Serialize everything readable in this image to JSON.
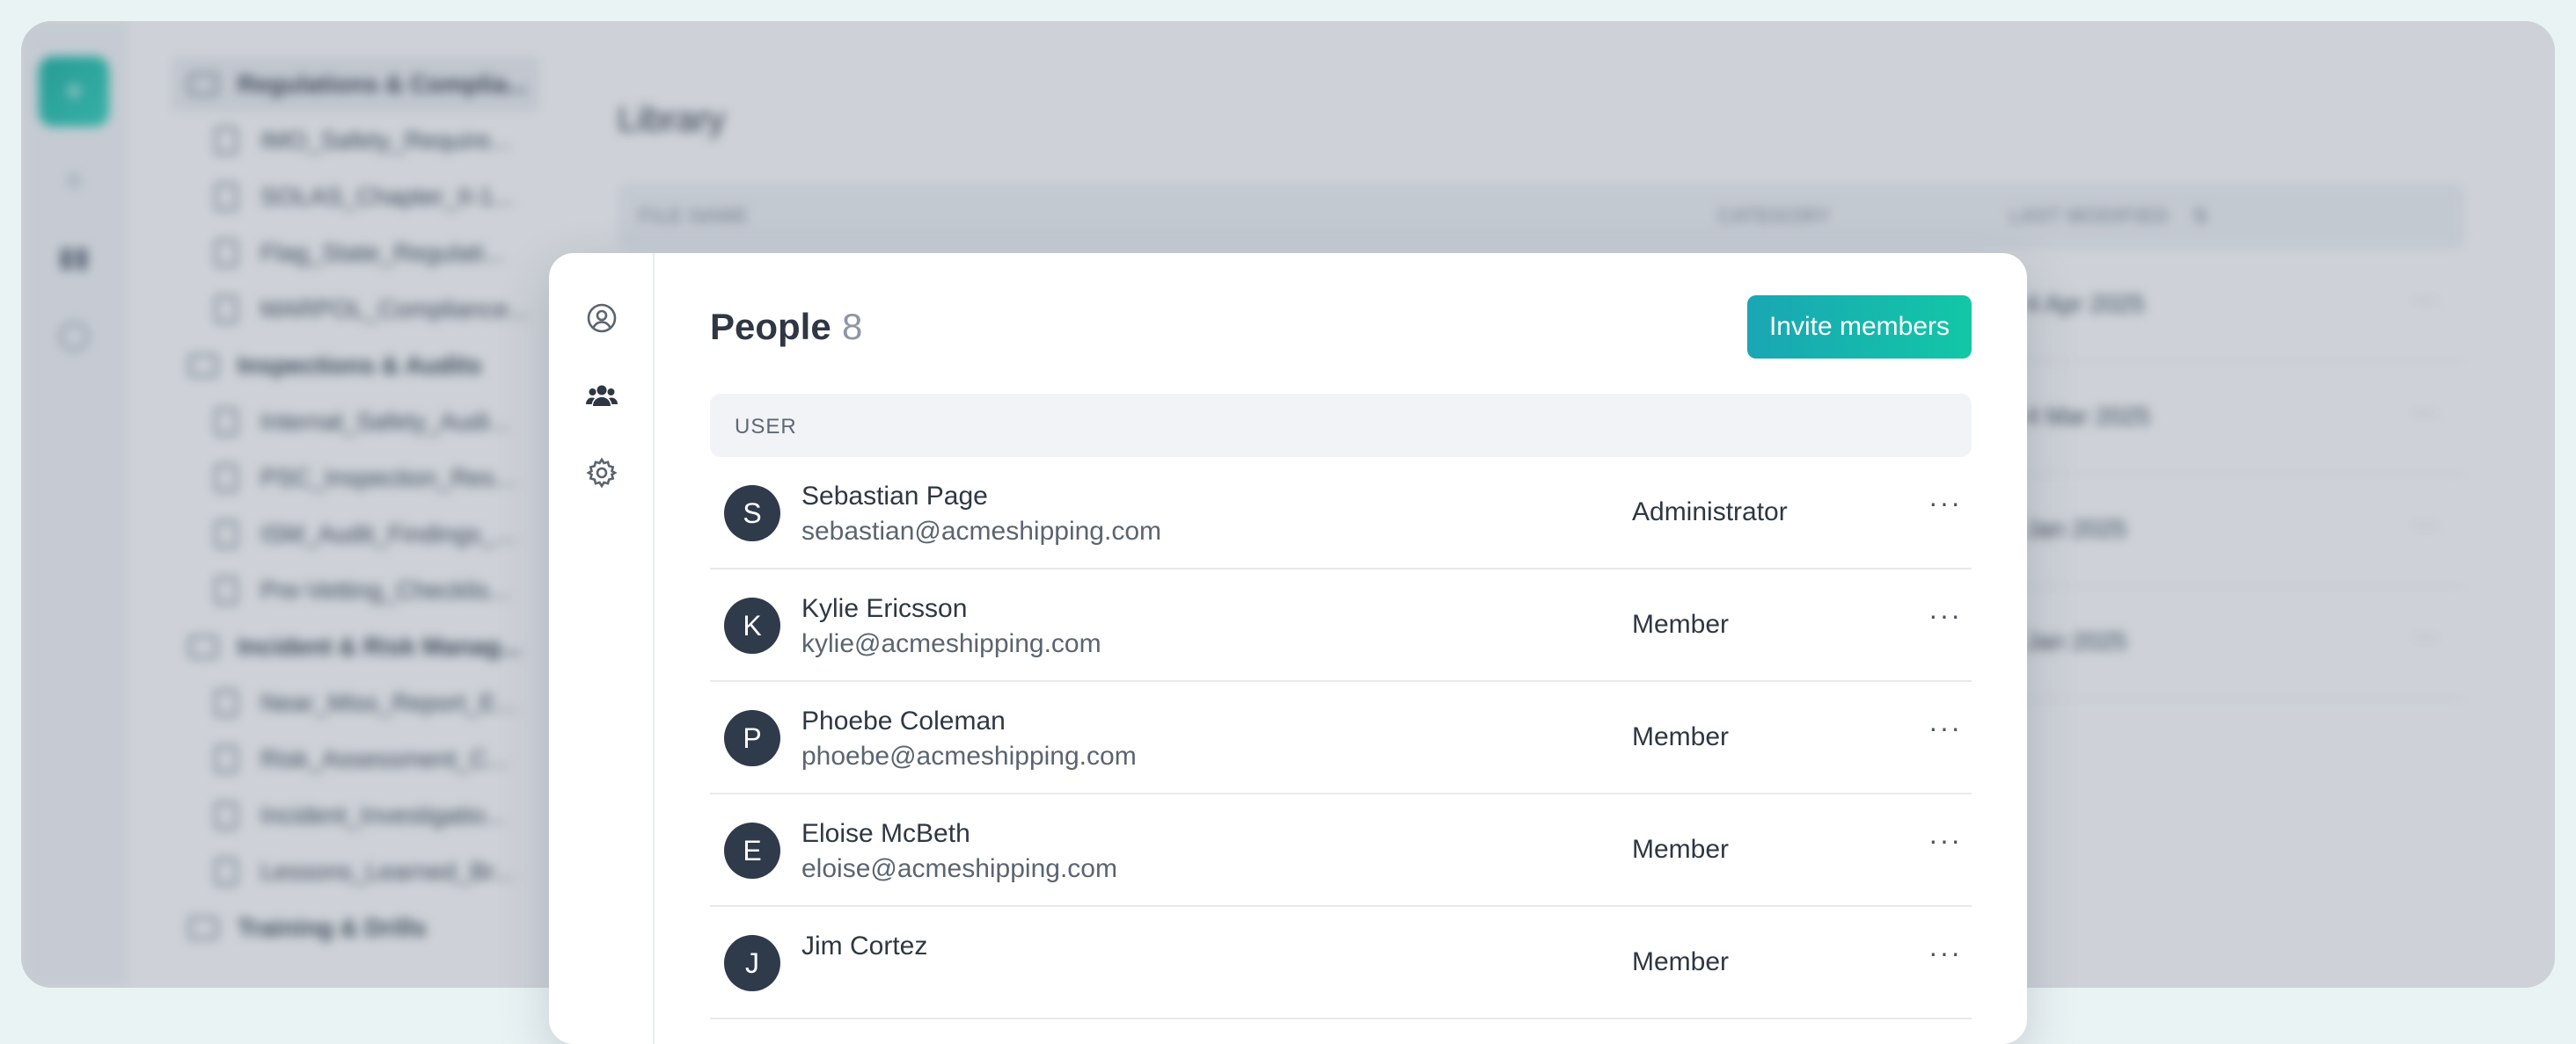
{
  "background": {
    "tree": [
      {
        "type": "folder",
        "label": "Regulations & Complia..."
      },
      {
        "type": "file",
        "label": "IMO_Safety_Require..."
      },
      {
        "type": "file",
        "label": "SOLAS_Chapter_II-1..."
      },
      {
        "type": "file",
        "label": "Flag_State_Regulati..."
      },
      {
        "type": "file",
        "label": "MARPOL_Compliance..."
      },
      {
        "type": "folder",
        "label": "Inspections & Audits"
      },
      {
        "type": "file",
        "label": "Internal_Safety_Audi..."
      },
      {
        "type": "file",
        "label": "PSC_Inspection_Res..."
      },
      {
        "type": "file",
        "label": "ISM_Audit_Findings_..."
      },
      {
        "type": "file",
        "label": "Pre-Vetting_Checklis..."
      },
      {
        "type": "folder",
        "label": "Incident & Risk Manag..."
      },
      {
        "type": "file",
        "label": "Near_Miss_Report_E..."
      },
      {
        "type": "file",
        "label": "Risk_Assessment_C..."
      },
      {
        "type": "file",
        "label": "Incident_Investigatio..."
      },
      {
        "type": "file",
        "label": "Lessons_Learned_Br..."
      },
      {
        "type": "folder",
        "label": "Training & Drills"
      }
    ],
    "library": {
      "title": "Library",
      "columns": {
        "file_name": "FILE NAME",
        "category": "CATEGORY",
        "last_modified": "LAST MODIFIED"
      },
      "sort_icon": "sort-icon",
      "rows": [
        {
          "date": "4 Apr 2025"
        },
        {
          "date": "4 Mar 2025"
        },
        {
          "date": "Jan 2025"
        },
        {
          "date": "Jan 2025"
        }
      ]
    }
  },
  "modal": {
    "rail_icons": [
      "user-circle-icon",
      "users-icon",
      "gear-icon"
    ],
    "title": "People",
    "count": "8",
    "invite_label": "Invite members",
    "table_header": "USER",
    "users": [
      {
        "initial": "S",
        "name": "Sebastian Page",
        "email": "sebastian@acmeshipping.com",
        "role": "Administrator"
      },
      {
        "initial": "K",
        "name": "Kylie Ericsson",
        "email": "kylie@acmeshipping.com",
        "role": "Member"
      },
      {
        "initial": "P",
        "name": "Phoebe Coleman",
        "email": "phoebe@acmeshipping.com",
        "role": "Member"
      },
      {
        "initial": "E",
        "name": "Eloise McBeth",
        "email": "eloise@acmeshipping.com",
        "role": "Member"
      },
      {
        "initial": "J",
        "name": "Jim Cortez",
        "email": "",
        "role": "Member"
      }
    ],
    "row_menu_label": "···"
  },
  "colors": {
    "accent_start": "#1aa6b4",
    "accent_end": "#12c7a6",
    "avatar_bg": "#2f3a4b",
    "scrim": "rgba(58,74,100,0.25)"
  }
}
